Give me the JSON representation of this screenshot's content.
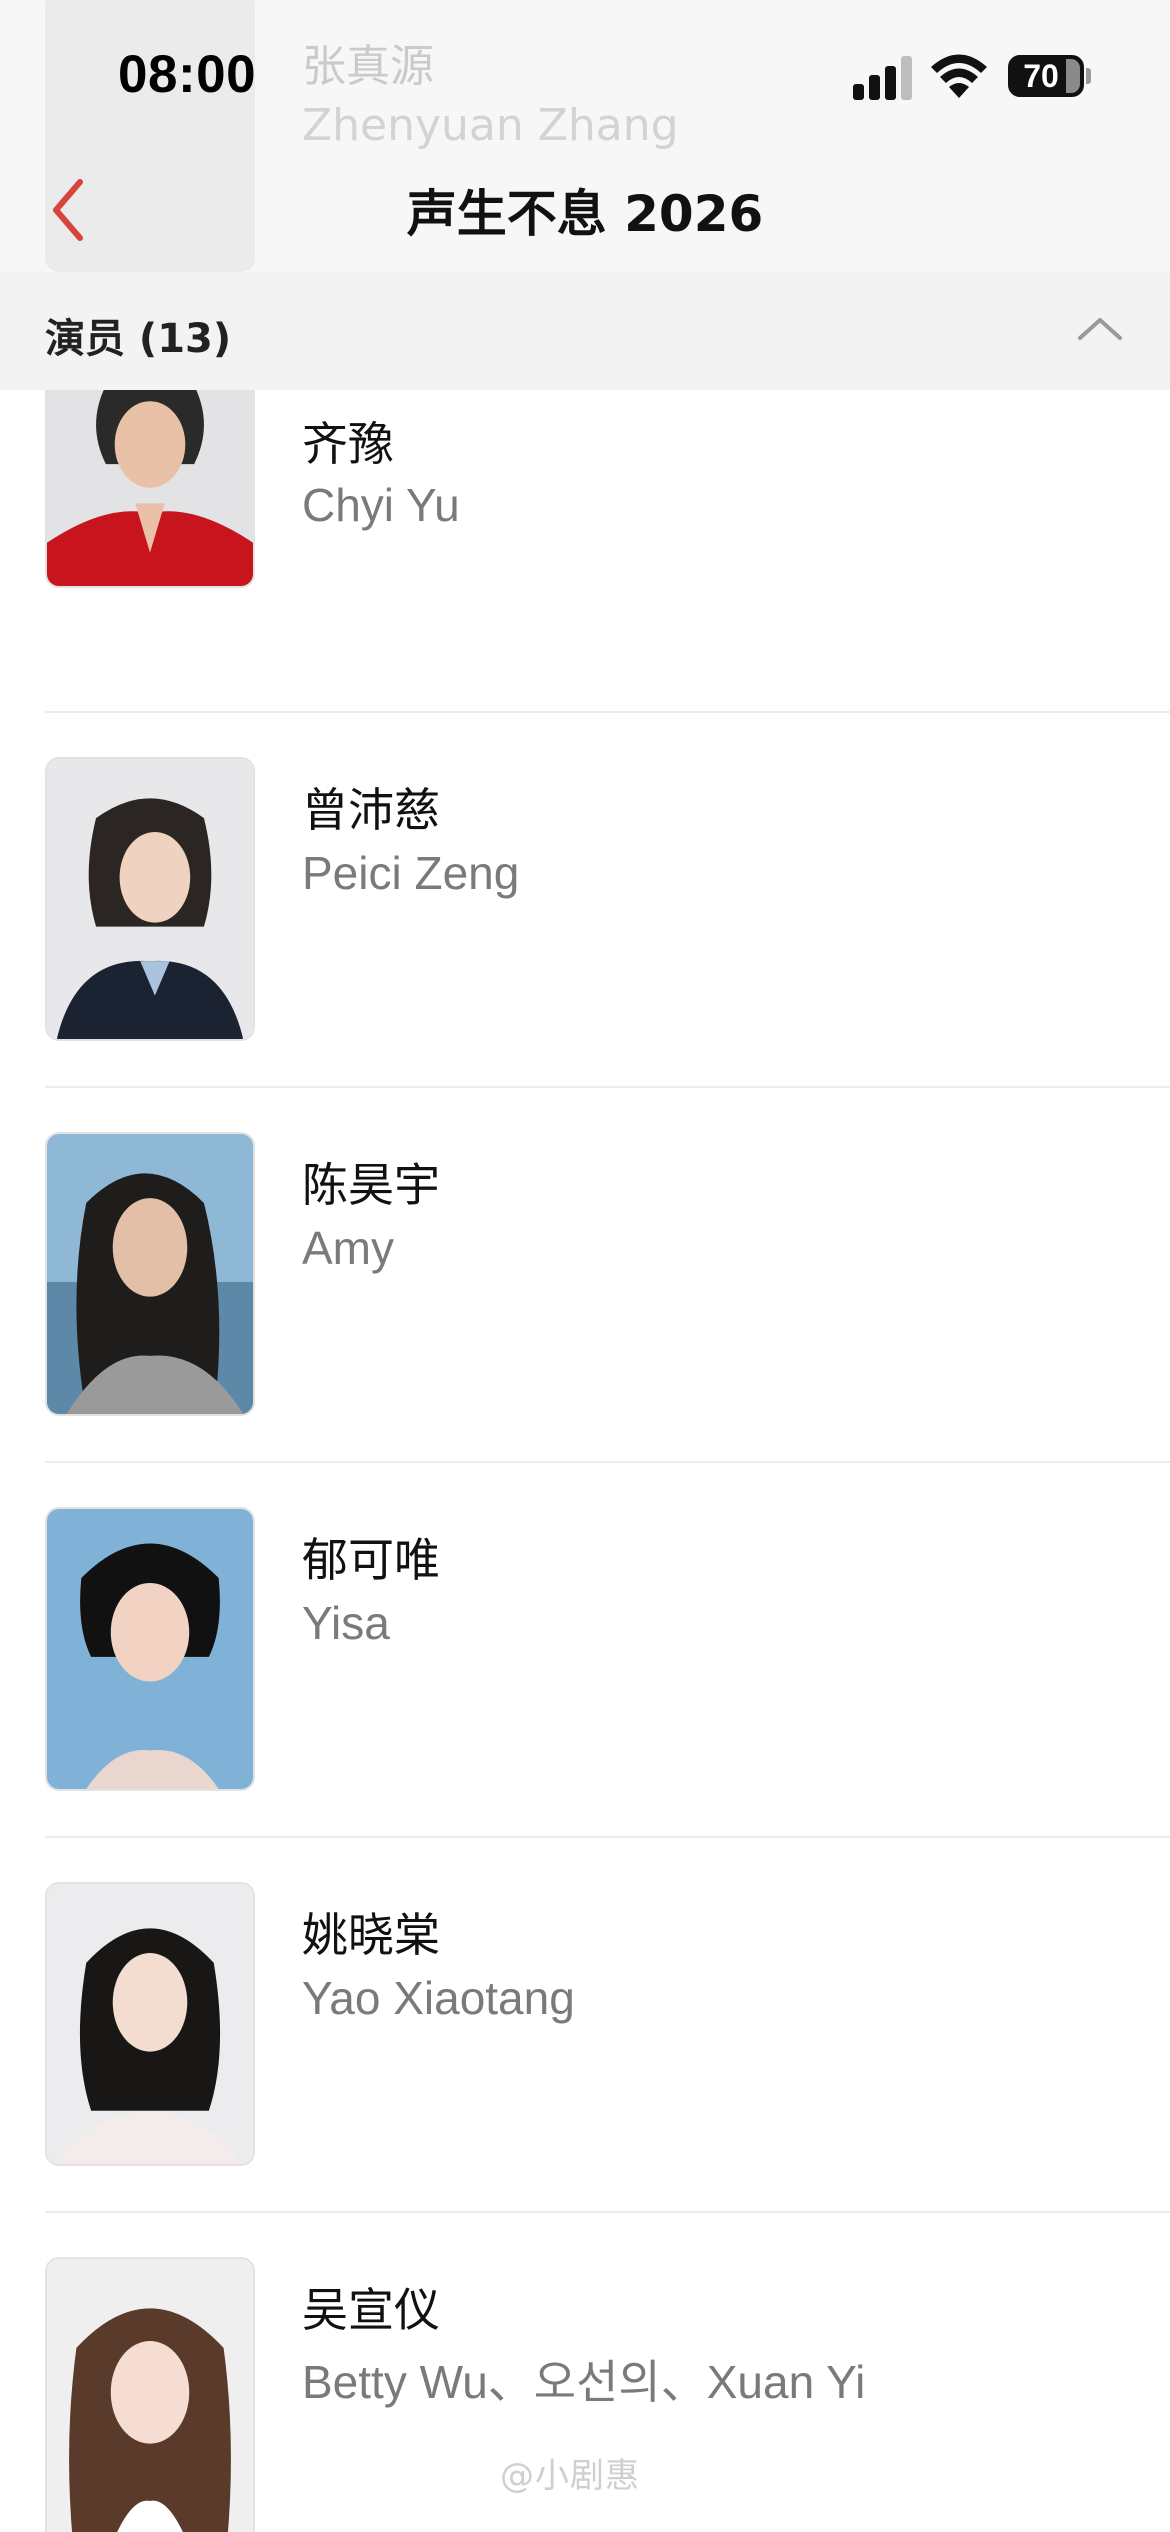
{
  "status_bar": {
    "time": "08:00",
    "battery": "70"
  },
  "nav": {
    "title": "声生不息 2026"
  },
  "ghost": {
    "name": "张真源",
    "en": "Zhenyuan Zhang"
  },
  "section": {
    "title": "演员 (13)"
  },
  "cast": [
    {
      "cn": "齐豫",
      "en": "Chyi Yu"
    },
    {
      "cn": "曾沛慈",
      "en": "Peici Zeng"
    },
    {
      "cn": "陈昊宇",
      "en": "Amy"
    },
    {
      "cn": "郁可唯",
      "en": "Yisa"
    },
    {
      "cn": "姚晓棠",
      "en": "Yao Xiaotang"
    },
    {
      "cn": "吴宣仪",
      "en": "Betty Wu、오선의、Xuan Yi"
    }
  ],
  "watermark": "@小剧惠",
  "colors": {
    "accent_red": "#d6453b",
    "header_bg": "#f3f3f3",
    "secondary_text": "#7a7a7a"
  }
}
